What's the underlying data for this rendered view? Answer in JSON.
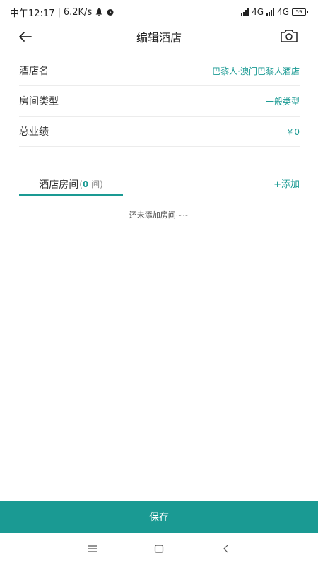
{
  "status_bar": {
    "time": "中午12:17",
    "separator": "|",
    "speed": "6.2K/s",
    "network_1": "4G",
    "network_2": "4G",
    "battery": "59"
  },
  "header": {
    "title": "编辑酒店"
  },
  "form": {
    "hotel_name_label": "酒店名",
    "hotel_name_value": "巴黎人·澳门巴黎人酒店",
    "room_type_label": "房间类型",
    "room_type_value": "一般类型",
    "total_label": "总业绩",
    "total_value": "￥0"
  },
  "rooms": {
    "tab_label": "酒店房间",
    "count_open": "(",
    "count_value": "0",
    "count_unit": " 间)",
    "add_label": "+添加",
    "empty_text": "还未添加房间~~"
  },
  "footer": {
    "save_label": "保存"
  },
  "icons": {
    "back": "arrow-left-icon",
    "camera": "camera-icon",
    "nav_menu": "menu-icon",
    "nav_home": "home-icon",
    "nav_back": "back-icon"
  },
  "colors": {
    "accent": "#1a9a93"
  }
}
